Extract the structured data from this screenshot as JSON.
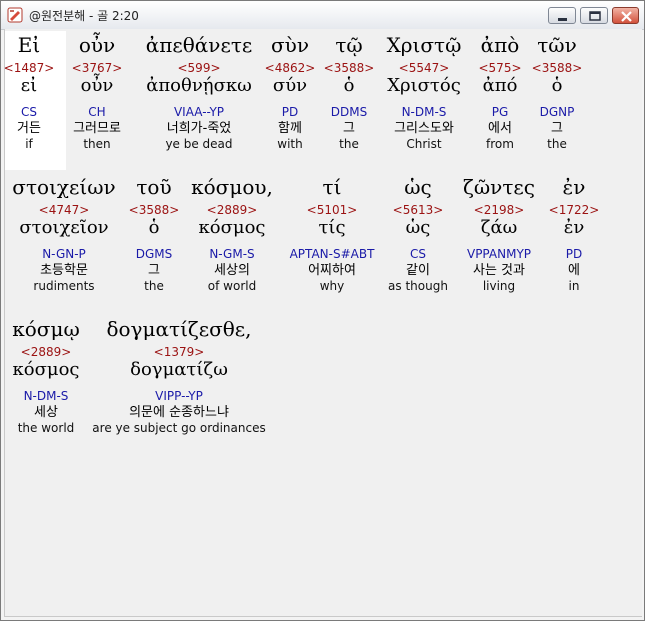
{
  "window": {
    "title": "@원전분해 - 골 2:20",
    "buttons": {
      "minimize": "minimize",
      "maximize": "maximize",
      "close": "close"
    }
  },
  "rows": [
    {
      "words": [
        {
          "greek": "Εἰ",
          "strong": "<1487>",
          "lemma": "εἰ",
          "morph": "CS",
          "korean": "거든",
          "english": "if"
        },
        {
          "greek": "οὖν",
          "strong": "<3767>",
          "lemma": "οὖν",
          "morph": "CH",
          "korean": "그러므로",
          "english": "then"
        },
        {
          "greek": "ἀπεθάνετε",
          "strong": "<599>",
          "lemma": "ἀποθνῄσκω",
          "morph": "VIAA--YP",
          "korean": "너희가-죽었",
          "english": "ye be dead"
        },
        {
          "greek": "σὺν",
          "strong": "<4862>",
          "lemma": "σύν",
          "morph": "PD",
          "korean": "함께",
          "english": "with"
        },
        {
          "greek": "τῷ",
          "strong": "<3588>",
          "lemma": "ὁ",
          "morph": "DDMS",
          "korean": "그",
          "english": "the"
        },
        {
          "greek": "Χριστῷ",
          "strong": "<5547>",
          "lemma": "Χριστός",
          "morph": "N-DM-S",
          "korean": "그리스도와",
          "english": "Christ"
        },
        {
          "greek": "ἀπὸ",
          "strong": "<575>",
          "lemma": "ἀπό",
          "morph": "PG",
          "korean": "에서",
          "english": "from"
        },
        {
          "greek": "τῶν",
          "strong": "<3588>",
          "lemma": "ὁ",
          "morph": "DGNP",
          "korean": "그",
          "english": "the"
        }
      ]
    },
    {
      "words": [
        {
          "greek": "στοιχείων",
          "strong": "<4747>",
          "lemma": "στοιχεῖον",
          "morph": "N-GN-P",
          "korean": "초등학문",
          "english": "rudiments"
        },
        {
          "greek": "τοῦ",
          "strong": "<3588>",
          "lemma": "ὁ",
          "morph": "DGMS",
          "korean": "그",
          "english": "the"
        },
        {
          "greek": "κόσμου,",
          "strong": "<2889>",
          "lemma": "κόσμος",
          "morph": "N-GM-S",
          "korean": "세상의",
          "english": "of world"
        },
        {
          "greek": "τί",
          "strong": "<5101>",
          "lemma": "τίς",
          "morph": "APTAN-S#ABT",
          "korean": "어찌하여",
          "english": "why"
        },
        {
          "greek": "ὡς",
          "strong": "<5613>",
          "lemma": "ὡς",
          "morph": "CS",
          "korean": "같이",
          "english": "as though"
        },
        {
          "greek": "ζῶντες",
          "strong": "<2198>",
          "lemma": "ζάω",
          "morph": "VPPANMYP",
          "korean": "사는 것과",
          "english": "living"
        },
        {
          "greek": "ἐν",
          "strong": "<1722>",
          "lemma": "ἐν",
          "morph": "PD",
          "korean": "에",
          "english": "in"
        }
      ]
    },
    {
      "words": [
        {
          "greek": "κόσμῳ",
          "strong": "<2889>",
          "lemma": "κόσμος",
          "morph": "N-DM-S",
          "korean": "세상",
          "english": "the world"
        },
        {
          "greek": "δογματίζεσθε,",
          "strong": "<1379>",
          "lemma": "δογματίζω",
          "morph": "VIPP--YP",
          "korean": "의문에 순종하느냐",
          "english": "are ye subject go ordinances"
        }
      ]
    }
  ]
}
